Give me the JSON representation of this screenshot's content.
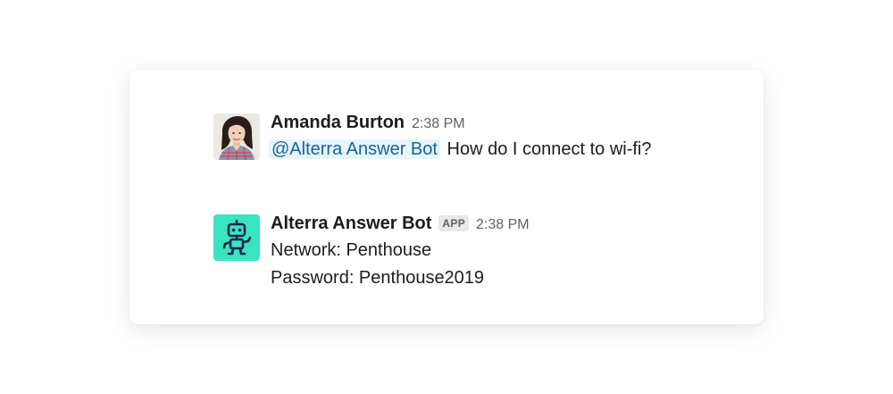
{
  "messages": [
    {
      "sender": "Amanda Burton",
      "timestamp": "2:38 PM",
      "mention": "@Alterra Answer Bot",
      "text": "How do I connect to wi-fi?"
    },
    {
      "sender": "Alterra Answer Bot",
      "badge": "APP",
      "timestamp": "2:38 PM",
      "lines": [
        "Network: Penthouse",
        "Password: Penthouse2019"
      ]
    }
  ],
  "colors": {
    "bot_avatar_bg": "#3be4c1",
    "bot_icon": "#0b2a4a",
    "mention_text": "#1264a3",
    "mention_bg": "#e8f5fa"
  },
  "icons": {
    "user_avatar": "user-photo-avatar",
    "bot_avatar": "robot-icon"
  }
}
